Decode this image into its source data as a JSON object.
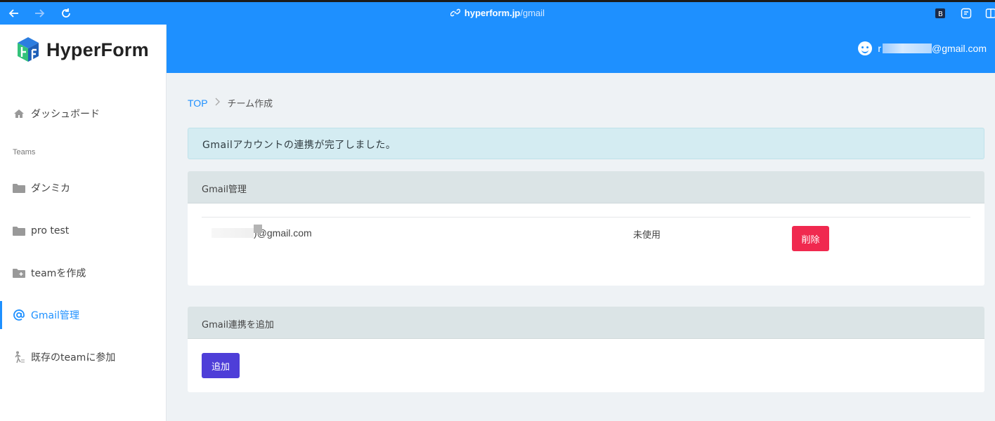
{
  "browser": {
    "url_domain": "hyperform.jp",
    "url_path": "/gmail"
  },
  "app": {
    "logo_text": "HyperForm",
    "user_email_prefix": "r",
    "user_email_suffix": "@gmail.com"
  },
  "sidebar": {
    "items": [
      {
        "label": "ダッシュボード",
        "icon": "home-icon"
      },
      {
        "label": "ダンミカ",
        "icon": "folder-icon"
      },
      {
        "label": "pro test",
        "icon": "folder-icon"
      },
      {
        "label": "teamを作成",
        "icon": "folder-plus-icon"
      },
      {
        "label": "Gmail管理",
        "icon": "at-icon",
        "active": true
      },
      {
        "label": "既存のteamに参加",
        "icon": "walking-person-icon"
      }
    ],
    "section_label": "Teams"
  },
  "breadcrumb": {
    "top": "TOP",
    "current": "チーム作成"
  },
  "alert": {
    "message": "Gmailアカウントの連携が完了しました。"
  },
  "gmail_card": {
    "title": "Gmail管理",
    "rows": [
      {
        "email_suffix": ")@gmail.com",
        "status": "未使用",
        "delete_label": "削除"
      }
    ]
  },
  "add_card": {
    "title": "Gmail連携を追加",
    "add_label": "追加"
  },
  "colors": {
    "primary": "#1e90ff",
    "danger": "#f0294f",
    "add_button": "#4e3ed8",
    "alert_bg": "#d4ecf2"
  }
}
